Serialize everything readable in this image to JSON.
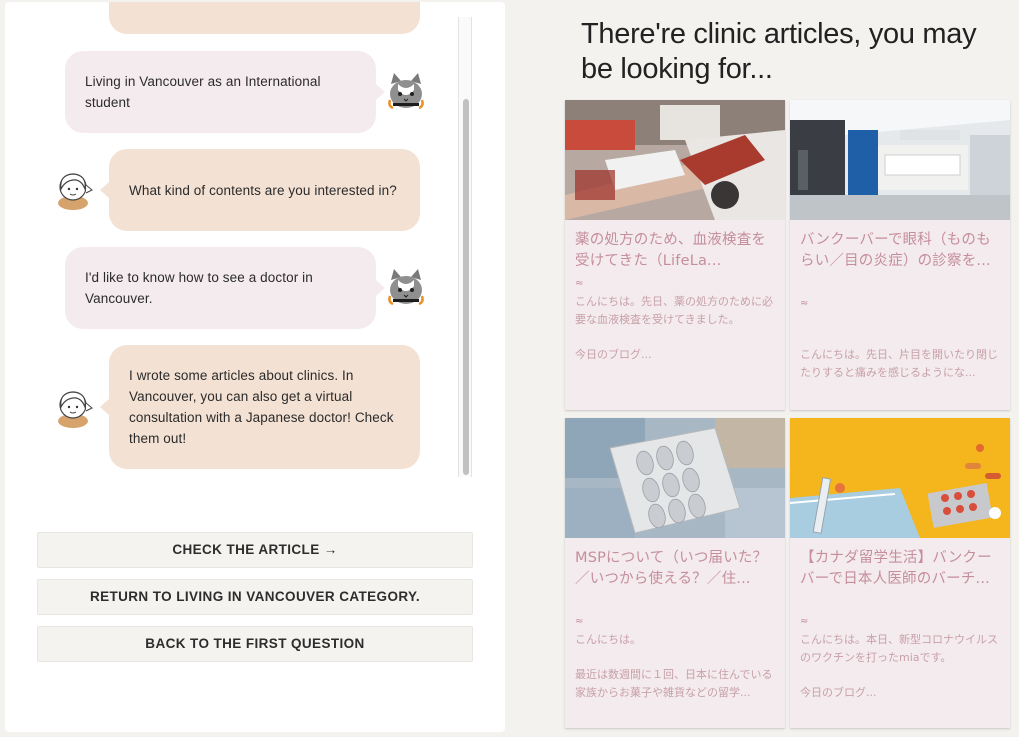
{
  "chat": {
    "messages": [
      {
        "role": "user",
        "text": "Living in Vancouver as an International student"
      },
      {
        "role": "bot",
        "text": "What kind of contents are you interested in?"
      },
      {
        "role": "user",
        "text": "I'd like to know how to see a doctor in Vancouver."
      },
      {
        "role": "bot",
        "text": "I wrote some articles about clinics. In Vancouver, you can also get a virtual consultation with a Japanese doctor! Check them out!"
      }
    ],
    "user_avatar_icon": "cat-avatar-icon",
    "bot_avatar_icon": "girl-avatar-icon"
  },
  "actions": {
    "check_article": "CHECK THE ARTICLE →",
    "return_category": "RETURN TO LIVING IN VANCOUVER CATEGORY.",
    "back_first": "BACK TO THE FIRST QUESTION"
  },
  "articles": {
    "heading": "There're clinic articles, you may be looking for...",
    "cards": [
      {
        "title": "薬の処方のため、血液検査を受けてきた（LifeLa...",
        "tilde": "≈",
        "excerpt": "こんにちは。先日、薬の処方のために必要な血液検査を受けてきました。\n\n今日のブログ...",
        "image": "blood-test-photo"
      },
      {
        "title": "バンクーバーで眼科（ものもらい／目の炎症）の診察を...",
        "tilde": "≈",
        "excerpt": "こんにちは。先日、片目を開いたり閉じたりすると痛みを感じるようにな...",
        "image": "clinic-reception-photo"
      },
      {
        "title": "MSPについて（いつ届いた？／いつから使える？／住...",
        "tilde": "≈",
        "excerpt": "こんにちは。\n\n最近は数週間に１回、日本に住んでいる家族からお菓子や雑貨などの留学...",
        "image": "pills-and-money-photo"
      },
      {
        "title": "【カナダ留学生活】バンクーバーで日本人医師のバーチ...",
        "tilde": "≈",
        "excerpt": "こんにちは。本日、新型コロナウイルスのワクチンを打ったmiaです。\n\n今日のブログ...",
        "image": "medicine-on-yellow-photo"
      }
    ]
  },
  "colors": {
    "user_bubble": "#f4ebef",
    "bot_bubble": "#f3e1d3",
    "card_bg": "#f4ebee",
    "card_title": "#c58e9c"
  }
}
